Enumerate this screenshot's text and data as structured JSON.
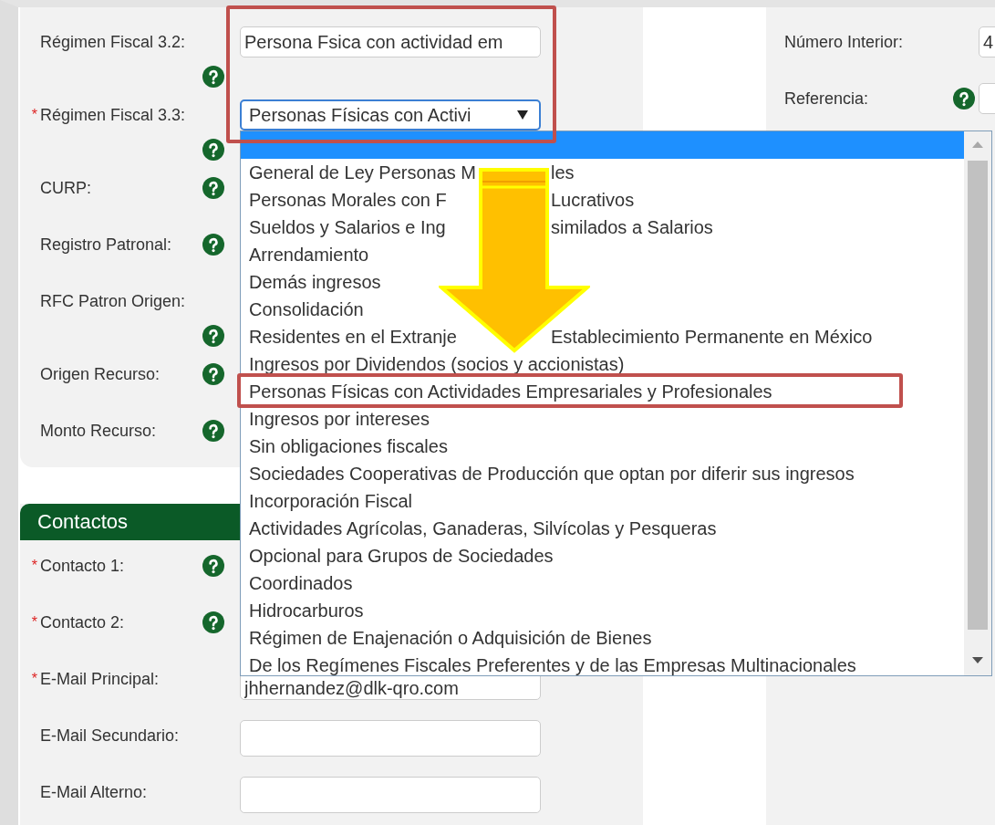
{
  "fiscal_section": {
    "rows": [
      {
        "label": "Régimen Fiscal 3.2:",
        "help": true,
        "kind": "input",
        "value": "Persona Fsica con actividad em"
      },
      {
        "required_mark": "*",
        "label": "Régimen Fiscal 3.3:",
        "help": true,
        "kind": "select",
        "value": "Personas Físicas con Activi"
      },
      {
        "label": "CURP:",
        "help": true,
        "kind": "label"
      },
      {
        "label": "Registro Patronal:",
        "help": true,
        "kind": "label"
      },
      {
        "label": "RFC Patron Origen:",
        "help": true,
        "kind": "label"
      },
      {
        "label": "Origen Recurso:",
        "help": true,
        "kind": "label"
      },
      {
        "label": "Monto Recurso:",
        "help": true,
        "kind": "label"
      }
    ]
  },
  "contacts_section": {
    "title": "Contactos",
    "rows": [
      {
        "required_mark": "*",
        "label": "Contacto 1:",
        "help": true,
        "kind": "label"
      },
      {
        "required_mark": "*",
        "label": "Contacto 2:",
        "help": true,
        "kind": "label"
      },
      {
        "required_mark": "*",
        "label": "E-Mail Principal:",
        "help": false,
        "kind": "input",
        "value": "jhhernandez@dlk-qro.com"
      },
      {
        "label": "E-Mail Secundario:",
        "help": false,
        "kind": "input"
      },
      {
        "label": "E-Mail Alterno:",
        "help": false,
        "kind": "input"
      }
    ]
  },
  "right_panel": {
    "rows": [
      {
        "label": "Número Interior:",
        "help": false,
        "kind": "input",
        "value": "4"
      },
      {
        "label": "Referencia:",
        "help": true,
        "kind": "input"
      }
    ]
  },
  "dropdown": {
    "options": [
      {
        "selected": true
      },
      {
        "label": "General de Ley Personas M",
        "label_right": "les",
        "selected": false
      },
      {
        "label": "Personas Morales con F",
        "label_right": "Lucrativos",
        "selected": false
      },
      {
        "label": "Sueldos y Salarios e Ing",
        "label_right": "similados a Salarios",
        "selected": false
      },
      {
        "label": "Arrendamiento",
        "selected": false
      },
      {
        "label": "Demás ingresos",
        "selected": false
      },
      {
        "label": "Consolidación",
        "selected": false
      },
      {
        "label": "Residentes en el Extranje",
        "label_right": "Establecimiento Permanente en México",
        "selected": false
      },
      {
        "label": "Ingresos por Dividendos (socios y accionistas)",
        "selected": false
      },
      {
        "label": "Personas Físicas con Actividades Empresariales y Profesionales",
        "selected": false
      },
      {
        "label": "Ingresos por intereses",
        "selected": false
      },
      {
        "label": "Sin obligaciones fiscales",
        "selected": false
      },
      {
        "label": "Sociedades Cooperativas de Producción que optan por diferir sus ingresos",
        "selected": false
      },
      {
        "label": "Incorporación Fiscal",
        "selected": false
      },
      {
        "label": "Actividades Agrícolas, Ganaderas, Silvícolas y Pesqueras",
        "selected": false
      },
      {
        "label": "Opcional para Grupos de Sociedades",
        "selected": false
      },
      {
        "label": "Coordinados",
        "selected": false
      },
      {
        "label": "Hidrocarburos",
        "selected": false
      },
      {
        "label": "Régimen de Enajenación o Adquisición de Bienes",
        "selected": false
      },
      {
        "label": "De los Regímenes Fiscales Preferentes y de las Empresas Multinacionales",
        "selected": false
      }
    ]
  },
  "annotations": [
    {
      "kind": "box"
    },
    {
      "kind": "box"
    },
    {
      "kind": "arrow"
    }
  ]
}
